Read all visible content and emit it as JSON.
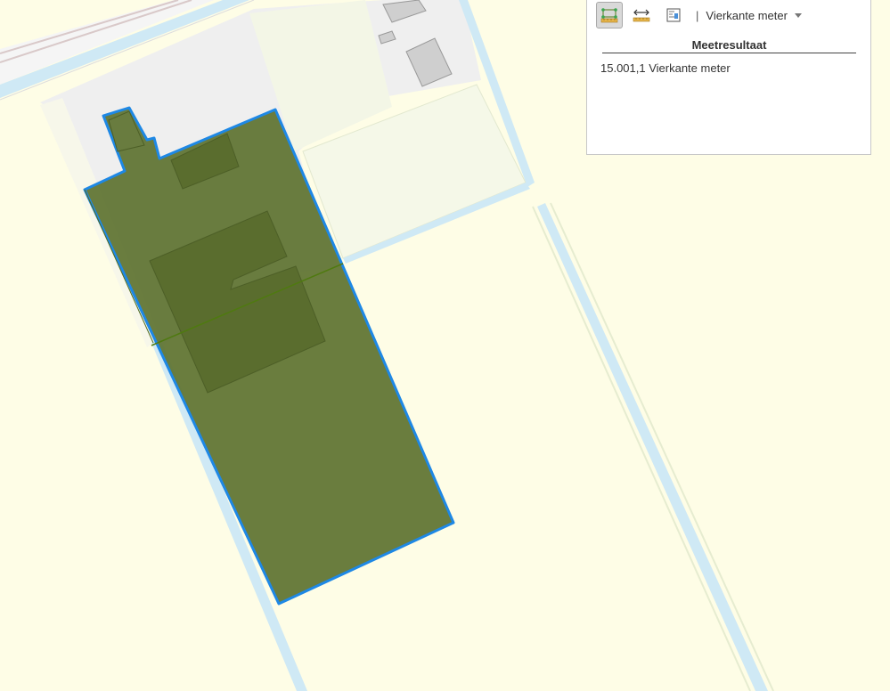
{
  "map": {
    "background_color": "#fefde6",
    "measured_area_fill": "#5d7230",
    "measured_area_outline": "#1e88e5",
    "water_color": "#cfe9f5",
    "paved_color": "#efefef",
    "building_color": "#c8c8c8"
  },
  "measure_panel": {
    "tools": [
      {
        "name": "area-tool",
        "icon": "area-measure-icon",
        "active": true
      },
      {
        "name": "distance-tool",
        "icon": "distance-measure-icon",
        "active": false
      },
      {
        "name": "location-tool",
        "icon": "location-measure-icon",
        "active": false
      }
    ],
    "separator": "|",
    "unit_selected": "Vierkante meter",
    "result_title": "Meetresultaat",
    "result_value": "15.001,1 Vierkante meter"
  }
}
